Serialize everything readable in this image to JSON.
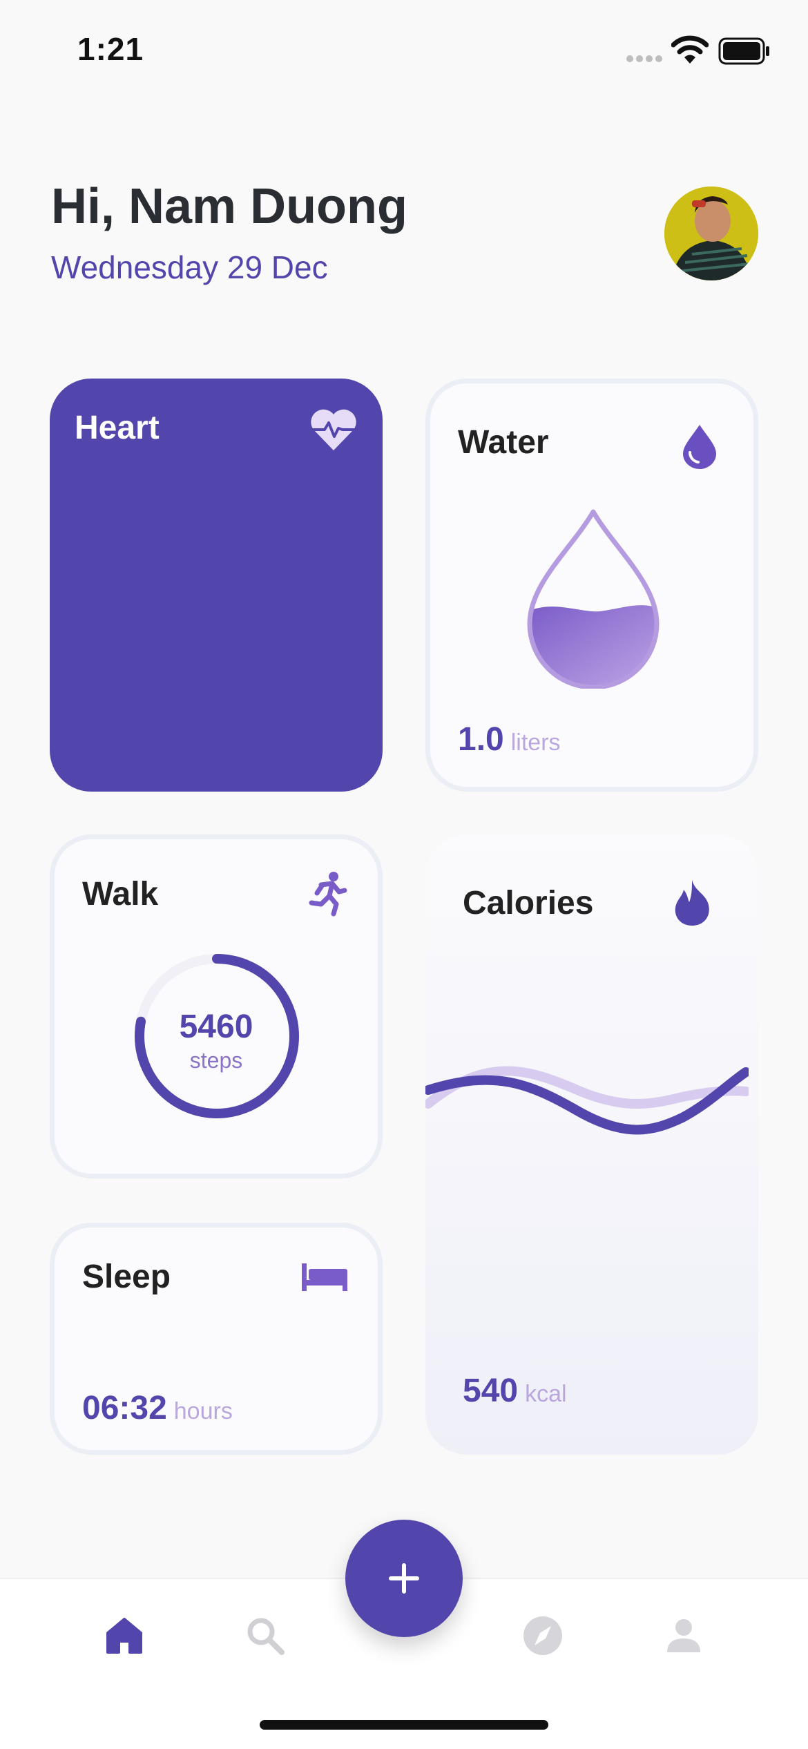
{
  "status_bar": {
    "time": "1:21"
  },
  "header": {
    "greeting": "Hi, Nam Duong",
    "date": "Wednesday 29 Dec"
  },
  "colors": {
    "primary": "#5246ac",
    "unit": "#b9a7dd",
    "background": "#f9f9f9"
  },
  "cards": {
    "heart": {
      "title": "Heart",
      "icon": "heart-pulse-icon"
    },
    "water": {
      "title": "Water",
      "icon": "water-drop-icon",
      "value": "1.0",
      "unit": "liters",
      "fill_level": 0.45
    },
    "walk": {
      "title": "Walk",
      "icon": "running-icon",
      "value": "5460",
      "unit": "steps",
      "progress": 0.78
    },
    "calories": {
      "title": "Calories",
      "icon": "fire-icon",
      "value": "540",
      "unit": "kcal"
    },
    "sleep": {
      "title": "Sleep",
      "icon": "bed-icon",
      "value": "06:32",
      "unit": "hours"
    }
  },
  "nav": {
    "items": [
      {
        "name": "home",
        "icon": "home-icon",
        "active": true
      },
      {
        "name": "search",
        "icon": "search-icon",
        "active": false
      },
      {
        "name": "add",
        "icon": "plus-icon",
        "active": false
      },
      {
        "name": "explore",
        "icon": "compass-icon",
        "active": false
      },
      {
        "name": "profile",
        "icon": "person-icon",
        "active": false
      }
    ]
  }
}
